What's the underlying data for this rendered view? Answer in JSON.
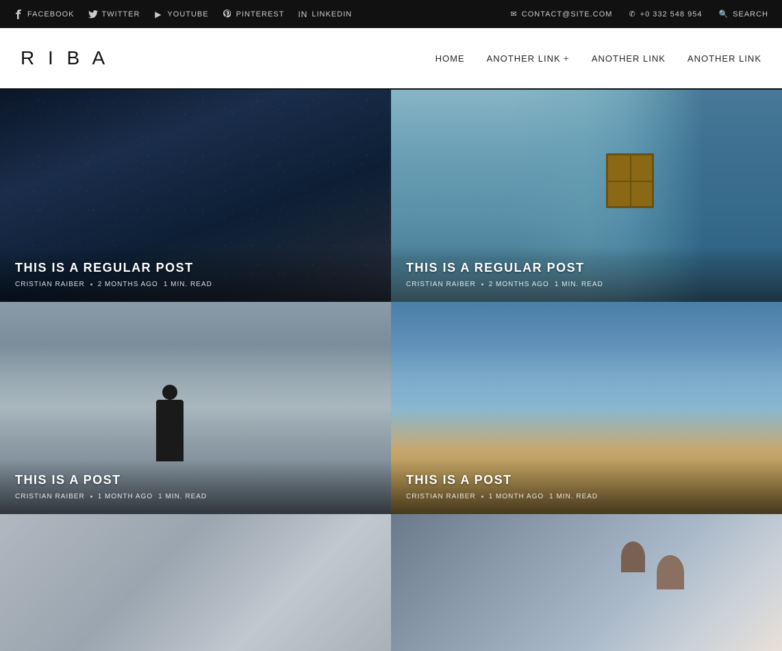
{
  "topbar": {
    "socials": [
      {
        "id": "facebook",
        "label": "FACEBOOK",
        "icon": "f"
      },
      {
        "id": "twitter",
        "label": "TWITTER",
        "icon": "t"
      },
      {
        "id": "youtube",
        "label": "YOUTUBE",
        "icon": "▶"
      },
      {
        "id": "pinterest",
        "label": "PINTEREST",
        "icon": "P"
      },
      {
        "id": "linkedin",
        "label": "LINKEDIN",
        "icon": "in"
      }
    ],
    "contact_email": "CONTACT@SITE.COM",
    "contact_phone": "+0 332 548 954",
    "search_label": "SEARCH"
  },
  "header": {
    "logo": "R I B A",
    "nav": [
      {
        "id": "home",
        "label": "HOME",
        "has_dropdown": false
      },
      {
        "id": "another1",
        "label": "ANOTHER LINK",
        "has_dropdown": true
      },
      {
        "id": "another2",
        "label": "ANOTHER LINK",
        "has_dropdown": false
      },
      {
        "id": "another3",
        "label": "ANOTHER LINK",
        "has_dropdown": false
      }
    ]
  },
  "posts": [
    {
      "id": "post-1",
      "title": "THIS IS A REGULAR POST",
      "author": "CRISTIAN RAIBER",
      "time_ago": "2 MONTHS AGO",
      "read_time": "1 MIN. READ",
      "bg_type": "night",
      "row": "top"
    },
    {
      "id": "post-2",
      "title": "THIS IS A REGULAR POST",
      "author": "CRISTIAN RAIBER",
      "time_ago": "2 MONTHS AGO",
      "read_time": "1 MIN. READ",
      "bg_type": "building",
      "row": "top"
    },
    {
      "id": "post-3",
      "title": "THIS IS A POST",
      "author": "CRISTIAN RAIBER",
      "time_ago": "1 MONTH AGO",
      "read_time": "1 MIN. READ",
      "bg_type": "foggy",
      "row": "middle"
    },
    {
      "id": "post-4",
      "title": "THIS IS A POST",
      "author": "CRISTIAN RAIBER",
      "time_ago": "1 MONTH AGO",
      "read_time": "1 MIN. READ",
      "bg_type": "beach",
      "row": "middle"
    }
  ]
}
